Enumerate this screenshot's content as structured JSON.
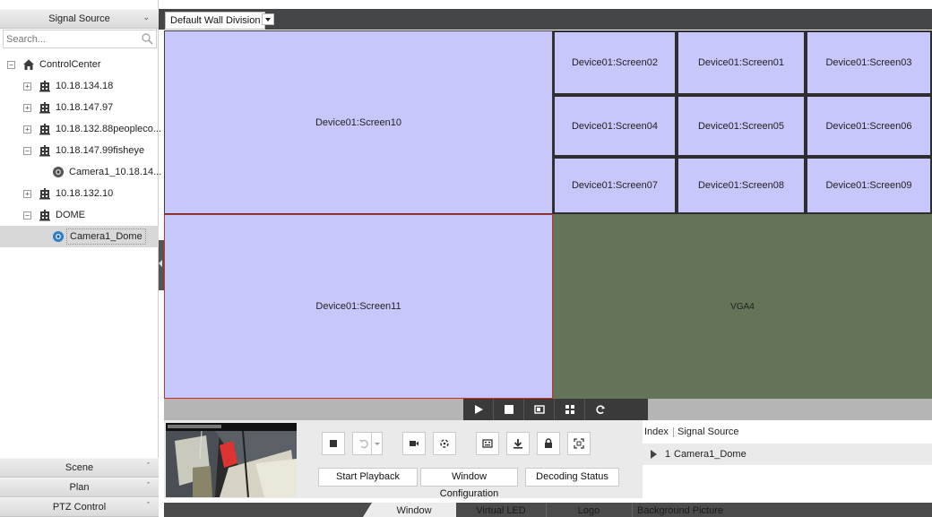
{
  "left_panel": {
    "signal_source_title": "Signal Source",
    "search_placeholder": "Search...",
    "tree": [
      {
        "label": "ControlCenter",
        "level": 0,
        "expander": "−",
        "icon": "home-icon"
      },
      {
        "label": "10.18.134.18",
        "level": 1,
        "expander": "+",
        "icon": "building-icon"
      },
      {
        "label": "10.18.147.97",
        "level": 1,
        "expander": "+",
        "icon": "building-icon"
      },
      {
        "label": "10.18.132.88peopleco...",
        "level": 1,
        "expander": "+",
        "icon": "building-icon"
      },
      {
        "label": "10.18.147.99fisheye",
        "level": 1,
        "expander": "−",
        "icon": "building-icon"
      },
      {
        "label": "Camera1_10.18.14...",
        "level": 2,
        "expander": "",
        "icon": "camera-icon"
      },
      {
        "label": "10.18.132.10",
        "level": 1,
        "expander": "+",
        "icon": "building-icon"
      },
      {
        "label": "DOME",
        "level": 1,
        "expander": "−",
        "icon": "building-icon"
      },
      {
        "label": "Camera1_Dome",
        "level": 2,
        "expander": "",
        "icon": "camera-online-icon",
        "selected": true
      }
    ],
    "scene_label": "Scene",
    "plan_label": "Plan",
    "ptz_label": "PTZ Control"
  },
  "topbar": {
    "wall_name": "Default Wall Division"
  },
  "wall": {
    "screens": {
      "s10": "Device01:Screen10",
      "s02": "Device01:Screen02",
      "s01": "Device01:Screen01",
      "s03": "Device01:Screen03",
      "s04": "Device01:Screen04",
      "s05": "Device01:Screen05",
      "s06": "Device01:Screen06",
      "s07": "Device01:Screen07",
      "s08": "Device01:Screen08",
      "s09": "Device01:Screen09",
      "s11": "Device01:Screen11",
      "vga": "VGA4"
    },
    "colors": {
      "screen_fill": "#c8c7fb",
      "selected_border": "#d42b2b",
      "vga_fill": "#637458"
    }
  },
  "controls": {
    "start_playback": "Start Playback",
    "window_configuration": "Window Configuration",
    "decoding_status": "Decoding Status",
    "signal_table": {
      "headers": [
        "Index",
        "Signal Source"
      ],
      "rows": [
        {
          "index": "1",
          "source": "Camera1_Dome"
        }
      ]
    }
  },
  "tabs": {
    "window": "Window",
    "virtual_led": "Virtual LED",
    "logo": "Logo",
    "background_picture": "Background Picture"
  }
}
